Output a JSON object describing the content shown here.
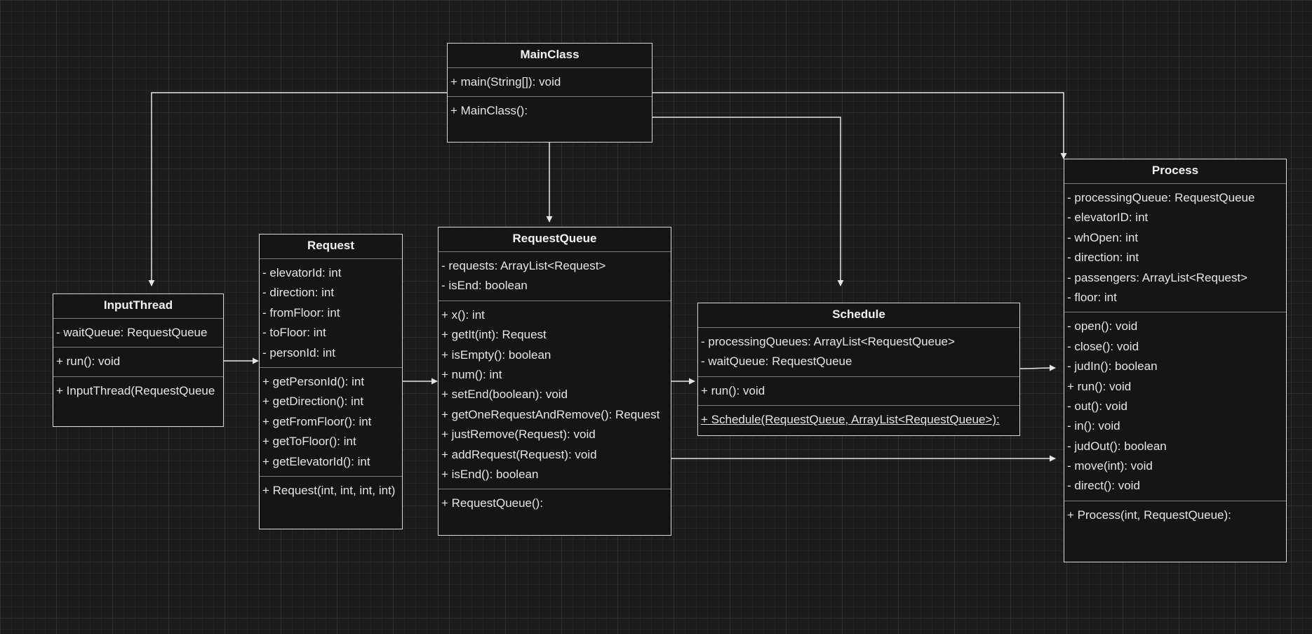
{
  "classes": {
    "main_class": {
      "name": "MainClass",
      "methods": [
        "+ main(String[]): void"
      ],
      "constructors": [
        "+ MainClass():"
      ]
    },
    "request": {
      "name": "Request",
      "fields": [
        "- elevatorId: int",
        "- direction: int",
        "- fromFloor: int",
        "- toFloor: int",
        "- personId: int"
      ],
      "methods": [
        "+ getPersonId(): int",
        "+ getDirection(): int",
        "+ getFromFloor(): int",
        "+ getToFloor(): int",
        "+ getElevatorId(): int"
      ],
      "constructors": [
        "+ Request(int, int, int, int)"
      ]
    },
    "request_queue": {
      "name": "RequestQueue",
      "fields": [
        "- requests: ArrayList<Request>",
        "- isEnd: boolean"
      ],
      "methods": [
        "+ x(): int",
        "+ getIt(int): Request",
        "+ isEmpty(): boolean",
        "+ num(): int",
        "+ setEnd(boolean): void",
        "+ getOneRequestAndRemove(): Request",
        "+ justRemove(Request): void",
        "+ addRequest(Request): void",
        "+ isEnd(): boolean"
      ],
      "constructors": [
        "+ RequestQueue():"
      ]
    },
    "input_thread": {
      "name": "InputThread",
      "fields": [
        "- waitQueue: RequestQueue"
      ],
      "methods": [
        "+ run(): void"
      ],
      "constructors": [
        "+ InputThread(RequestQueue"
      ]
    },
    "schedule": {
      "name": "Schedule",
      "fields": [
        "- processingQueues: ArrayList<RequestQueue>",
        "- waitQueue: RequestQueue"
      ],
      "methods": [
        "+ run(): void"
      ],
      "constructors": [
        "+ Schedule(RequestQueue, ArrayList<RequestQueue>):"
      ]
    },
    "process": {
      "name": "Process",
      "fields": [
        "- processingQueue: RequestQueue",
        "- elevatorID: int",
        "- whOpen: int",
        "- direction: int",
        "- passengers: ArrayList<Request>",
        "- floor: int"
      ],
      "methods": [
        "- open(): void",
        "- close(): void",
        "- judIn(): boolean",
        "+ run(): void",
        "- out(): void",
        "- in(): void",
        "- judOut(): boolean",
        "- move(int): void",
        "- direct(): void"
      ],
      "constructors": [
        "+ Process(int, RequestQueue):"
      ]
    }
  },
  "edges": [
    {
      "from": "MainClass",
      "to": "InputThread"
    },
    {
      "from": "MainClass",
      "to": "RequestQueue"
    },
    {
      "from": "MainClass",
      "to": "Schedule"
    },
    {
      "from": "MainClass",
      "to": "Process"
    },
    {
      "from": "InputThread",
      "to": "Request"
    },
    {
      "from": "Request",
      "to": "RequestQueue"
    },
    {
      "from": "RequestQueue",
      "to": "Schedule"
    },
    {
      "from": "RequestQueue",
      "to": "Process"
    },
    {
      "from": "Schedule",
      "to": "Process"
    }
  ],
  "colors": {
    "background": "#1b1b1b",
    "line": "#e6e6e6",
    "box_border": "#d9d9d9",
    "text": "#e6e6e6"
  }
}
